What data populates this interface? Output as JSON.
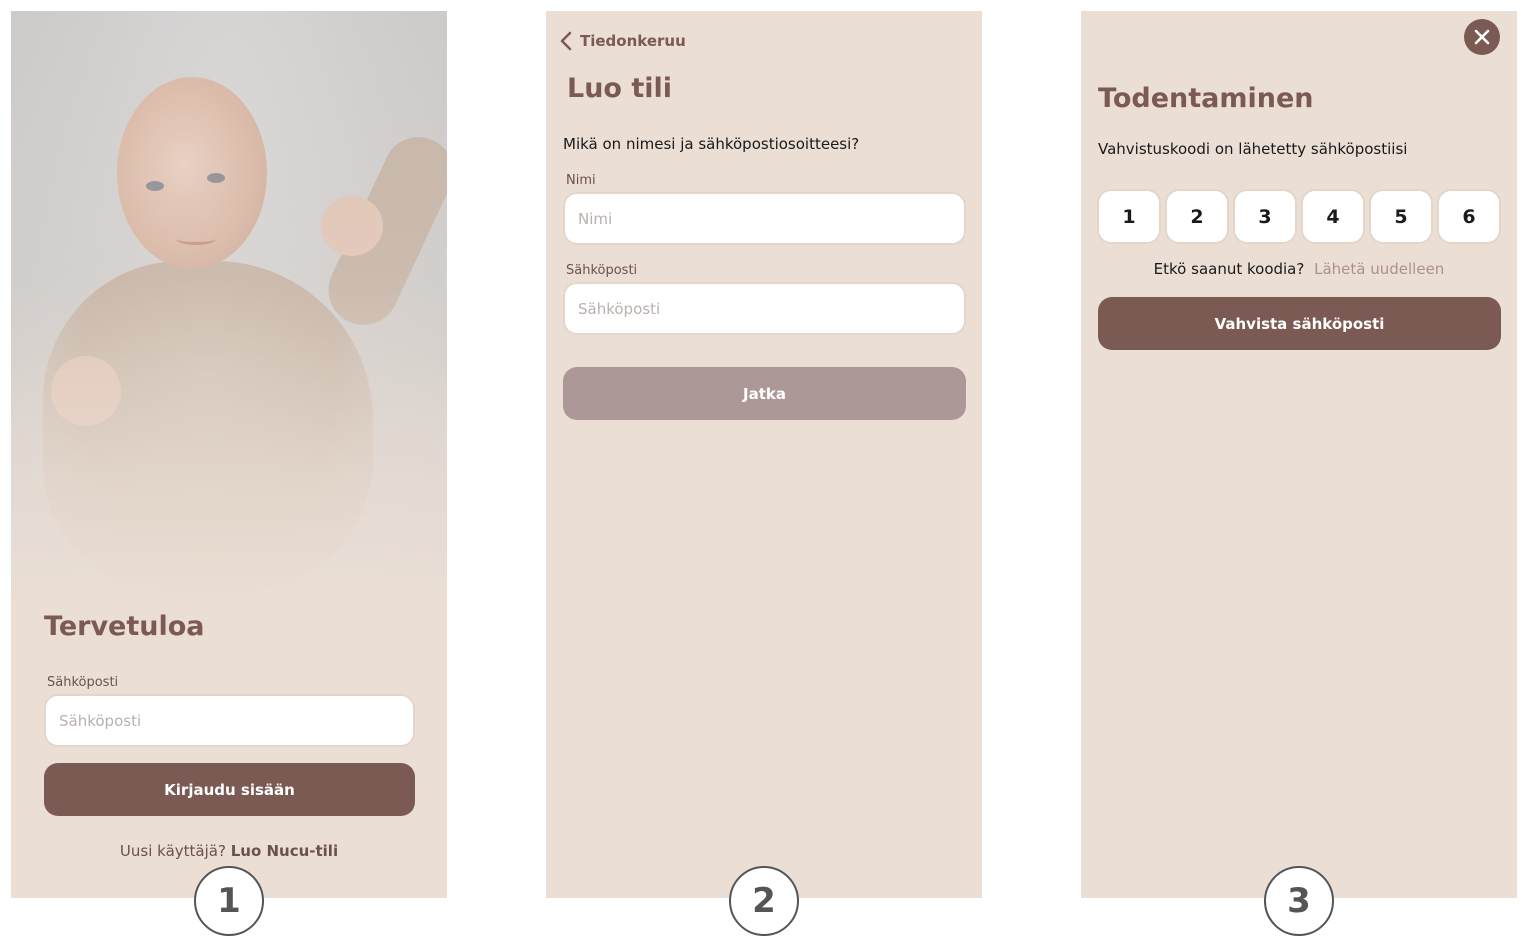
{
  "screen1": {
    "title": "Tervetuloa",
    "email_label": "Sähköposti",
    "email_placeholder": "Sähköposti",
    "login_button": "Kirjaudu sisään",
    "new_user_text": "Uusi käyttäjä?",
    "create_account_link": "Luo Nucu-tili"
  },
  "screen2": {
    "back_label": "Tiedonkeruu",
    "title": "Luo tili",
    "question": "Mikä on nimesi ja sähköpostiosoitteesi?",
    "name_label": "Nimi",
    "name_placeholder": "Nimi",
    "email_label": "Sähköposti",
    "email_placeholder": "Sähköposti",
    "continue_button": "Jatka"
  },
  "screen3": {
    "title": "Todentaminen",
    "subtitle": "Vahvistuskoodi on lähetetty sähköpostiisi",
    "code_digits": [
      "1",
      "2",
      "3",
      "4",
      "5",
      "6"
    ],
    "no_code_text": "Etkö saanut koodia?",
    "resend_link": "Lähetä uudelleen",
    "confirm_button": "Vahvista sähköposti"
  },
  "steps": [
    "1",
    "2",
    "3"
  ],
  "colors": {
    "background": "#ebdfd5",
    "primary": "#7a5a52",
    "disabled_button": "#ac9896",
    "link_muted": "#ab918a"
  }
}
